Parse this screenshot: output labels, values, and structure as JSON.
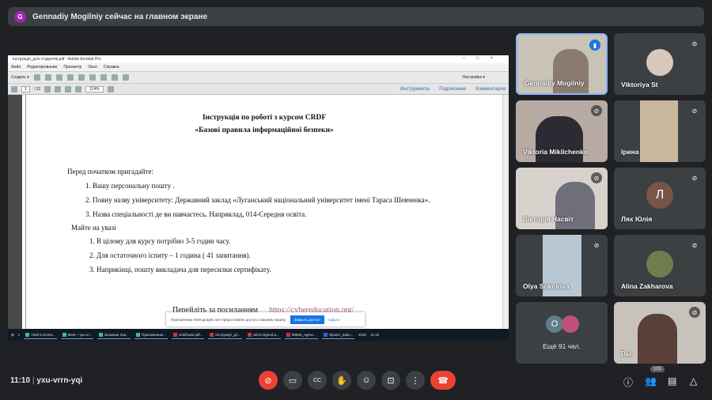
{
  "banner": {
    "avatar_letter": "G",
    "text": "Gennadiy Mogilniy сейчас на главном экране"
  },
  "acrobat": {
    "title": "інструкція_для студентів.pdf - Adobe Acrobat Pro",
    "menu": [
      "Файл",
      "Редактирование",
      "Просмотр",
      "Окно",
      "Справка"
    ],
    "create_label": "Создать ▾",
    "settings_label": "Настройка ▾",
    "page_current": "1",
    "page_total": "/ 22",
    "zoom": "114%",
    "right_links": [
      "Инструменты",
      "Подписание",
      "Комментарии"
    ]
  },
  "document": {
    "title1": "Інструкція по роботі з  курсом CRDF",
    "title2": "«Базові правила інформаційної безпеки»",
    "intro": "Перед початком пригадайте:",
    "list1": [
      "1.  Вашу персональну пошту .",
      "2.   Повну назву університету: Державний заклад «Луганський національний університет імені Тараса Шевченка».",
      "3.  Назва спеціальності де ви навчаєтесь. Наприклад, 014-Середня освіта."
    ],
    "note": "Майте на увазі",
    "list2": [
      "1.  В цілому для курсу потрібно  3-5 годин часу.",
      "2.  Для остаточного іспиту – 1 година ( 41 запитання).",
      "3.  Наприкінці,  пошту викладача для пересилки сертифікату."
    ],
    "link_prefix": "Перейдіть за посиланням",
    "link": "https://cybereducation.org/"
  },
  "share_bar": {
    "text": "Приложению meet.google.com предоставлен доступ к вашему экрану.",
    "stop": "Закрыть доступ",
    "hide": "Скрыть"
  },
  "taskbar": {
    "items": [
      "Total Comma...",
      "Meet – yxu-vr...",
      "Базовые пра...",
      "Приложению...",
      "certificate.pdf...",
      "інструкція_дл...",
      "MOU signed.p...",
      "69660_Agree...",
      "Проект_інфо..."
    ],
    "lang": "ENG",
    "time": "11:10"
  },
  "participants": [
    {
      "name": "Gennadiy Mogilniy",
      "speaking": true
    },
    {
      "name": "Viktoriya St"
    },
    {
      "name": "Viktoria Mikilchenko"
    },
    {
      "name": "Ірина"
    },
    {
      "name": "Вікторія Насвіт"
    },
    {
      "name": "Лях Юлія",
      "avatar_letter": "Л"
    },
    {
      "name": "Olya Sokolova"
    },
    {
      "name": "Alina Zakharova"
    },
    {
      "name": "Ещё 91 чел.",
      "avatar_letter": "О"
    },
    {
      "name": "Вы"
    }
  ],
  "meeting": {
    "time": "11:10",
    "code": "yxu-vrrn-yqi",
    "participant_count": "101"
  },
  "colors": {
    "background": "#202124",
    "tile": "#3c4043",
    "accent": "#1a73e8",
    "danger": "#ea4335"
  }
}
